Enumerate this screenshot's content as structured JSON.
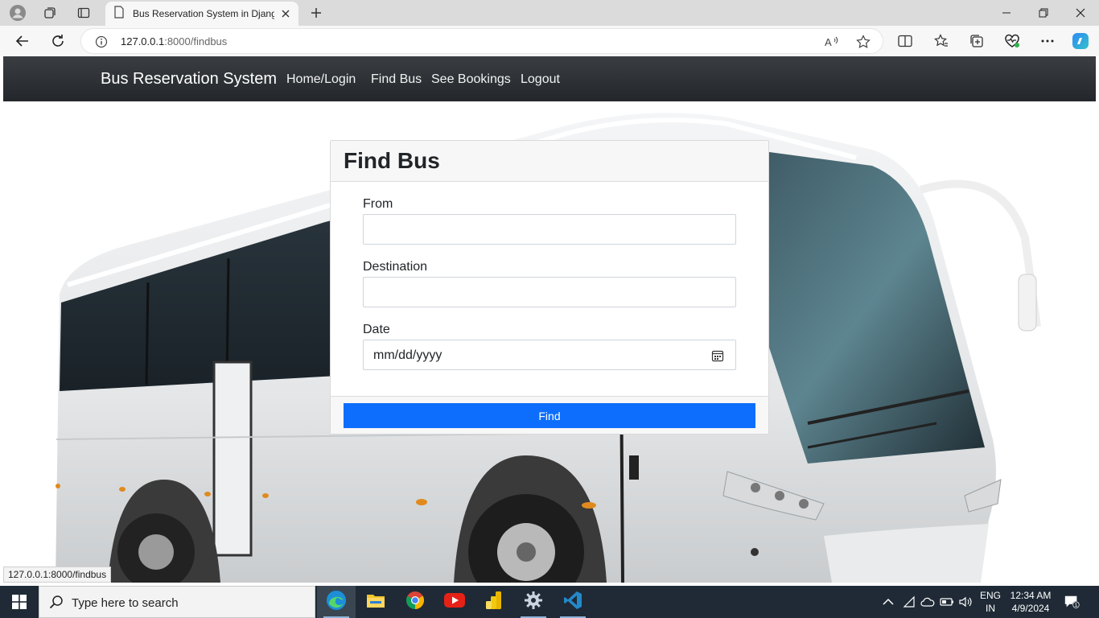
{
  "browser": {
    "tab_title": "Bus Reservation System in Django",
    "url_host": "127.0.0.1",
    "url_path": ":8000/findbus",
    "status_url": "127.0.0.1:8000/findbus"
  },
  "navbar": {
    "brand": "Bus Reservation System",
    "links": [
      "Home/Login",
      "Find Bus",
      "See Bookings",
      "Logout"
    ]
  },
  "form": {
    "title": "Find Bus",
    "from_label": "From",
    "from_value": "",
    "destination_label": "Destination",
    "destination_value": "",
    "date_label": "Date",
    "date_placeholder": "mm/dd/yyyy",
    "submit_label": "Find"
  },
  "taskbar": {
    "search_placeholder": "Type here to search",
    "lang_top": "ENG",
    "lang_bottom": "IN",
    "time": "12:34 AM",
    "date": "4/9/2024",
    "notification_count": "1"
  },
  "colors": {
    "navbar": "#2b3035",
    "primary_button": "#0d6efd",
    "taskbar": "#1f2a36"
  }
}
